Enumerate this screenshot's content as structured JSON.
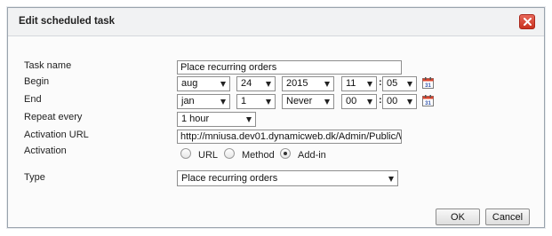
{
  "dialog": {
    "title": "Edit scheduled task",
    "close_icon": "close-icon"
  },
  "labels": {
    "task_name": "Task name",
    "begin": "Begin",
    "end": "End",
    "repeat_every": "Repeat every",
    "activation_url": "Activation URL",
    "activation": "Activation",
    "type": "Type"
  },
  "fields": {
    "task_name_value": "Place recurring orders",
    "begin": {
      "month": "aug",
      "day": "24",
      "year": "2015",
      "hour": "11",
      "minute": "05",
      "separator": ":"
    },
    "end": {
      "month": "jan",
      "day": "1",
      "year": "Never",
      "hour": "00",
      "minute": "00",
      "separator": ":"
    },
    "repeat_every": "1 hour",
    "activation_url_value": "http://mniusa.dev01.dynamicweb.dk/Admin/Public/W",
    "activation_options": [
      {
        "label": "URL",
        "checked": false
      },
      {
        "label": "Method",
        "checked": false
      },
      {
        "label": "Add-in",
        "checked": true
      }
    ],
    "type_value": "Place recurring orders"
  },
  "buttons": {
    "ok": "OK",
    "cancel": "Cancel"
  },
  "icons": {
    "calendar": "calendar-icon",
    "dropdown": "chevron-down-icon"
  }
}
